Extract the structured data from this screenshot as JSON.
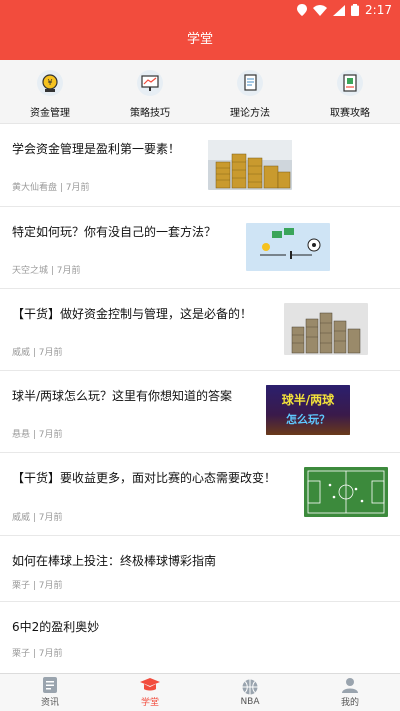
{
  "status": {
    "time": "2:17"
  },
  "header": {
    "title": "学堂"
  },
  "categories": [
    {
      "label": "资金管理",
      "icon": "money-management-icon"
    },
    {
      "label": "策略技巧",
      "icon": "strategy-board-icon"
    },
    {
      "label": "理论方法",
      "icon": "theory-document-icon"
    },
    {
      "label": "取赛攻略",
      "icon": "tips-card-icon"
    }
  ],
  "articles": [
    {
      "title": "学会资金管理是盈利第一要素！",
      "meta": "黄大仙看盘 | 7月前",
      "thumb": "coin-stacks-image"
    },
    {
      "title": "特定如何玩？你有没自己的一套方法？",
      "meta": "天空之城 | 7月前",
      "thumb": "money-soccer-cartoon-image"
    },
    {
      "title": "【干货】做好资金控制与管理，这是必备的！",
      "meta": "威威 | 7月前",
      "thumb": "coin-columns-image"
    },
    {
      "title": "球半/两球怎么玩？这里有你想知道的答案",
      "meta": "悬悬 | 7月前",
      "thumb": "banner-image"
    },
    {
      "title": "【干货】要收益更多，面对比赛的心态需要改变！",
      "meta": "威威 | 7月前",
      "thumb": "soccer-pitch-image"
    },
    {
      "title": "如何在棒球上投注：终极棒球博彩指南",
      "meta": "栗子 | 7月前",
      "thumb": ""
    },
    {
      "title": "6中2的盈利奥妙",
      "meta": "栗子 | 7月前",
      "thumb": ""
    }
  ],
  "thumb_texts": {
    "banner_line1": "球半/两球",
    "banner_line2": "怎么玩？"
  },
  "tabs": [
    {
      "label": "资讯",
      "icon": "news-icon",
      "active": false
    },
    {
      "label": "学堂",
      "icon": "graduation-cap-icon",
      "active": true
    },
    {
      "label": "NBA",
      "icon": "basketball-icon",
      "active": false
    },
    {
      "label": "我的",
      "icon": "profile-icon",
      "active": false
    }
  ],
  "colors": {
    "accent": "#f24c3d",
    "inactive_tab": "#555555",
    "meta_text": "#9a9a9a"
  }
}
